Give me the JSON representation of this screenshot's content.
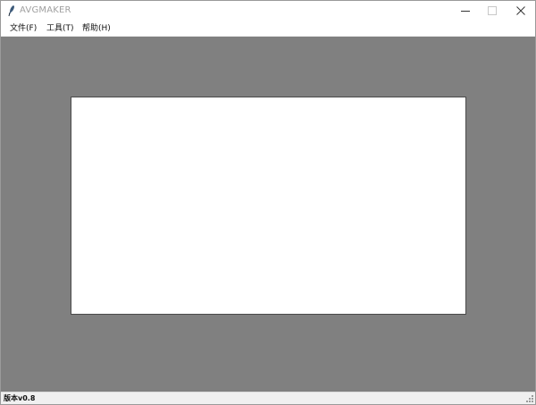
{
  "window": {
    "title": "AVGMAKER",
    "controls": [
      "minimize-icon",
      "maximize-icon",
      "close-icon"
    ]
  },
  "menubar": {
    "items": [
      {
        "label": "文件(F)"
      },
      {
        "label": "工具(T)"
      },
      {
        "label": "帮助(H)"
      }
    ]
  },
  "statusbar": {
    "version": "版本v0.8"
  },
  "colors": {
    "workspace_bg": "#808080",
    "canvas_bg": "#ffffff",
    "status_bg": "#f0f0f0"
  }
}
